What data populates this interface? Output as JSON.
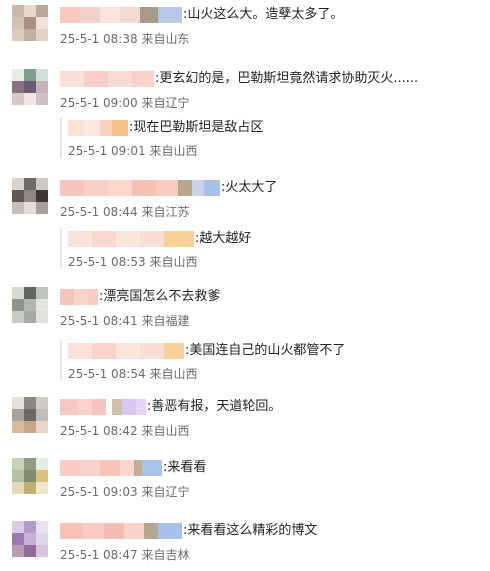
{
  "comments": [
    {
      "text": ":山火这么大。造孽太多了。",
      "date": "25-5-1 08:38",
      "location": "来自山东",
      "avatar_colors": [
        "#c9b8a8",
        "#e8d8cc",
        "#b9a79a",
        "#d3c1b3",
        "#a89182",
        "#efe3d9",
        "#dccbbd",
        "#c2b0a1",
        "#e2d3c6"
      ],
      "nick_colors": [
        "#f7c9c0",
        "#f3d2cc",
        "#fbe3de",
        "#f5d8d2",
        "#a79a86",
        "#b7c7e6"
      ]
    },
    {
      "text": ":更玄幻的是，巴勒斯坦竟然请求协助灭火......",
      "date": "25-5-1 09:00",
      "location": "来自辽宁",
      "avatar_colors": [
        "#e6ece6",
        "#7fa08c",
        "#d4ddd8",
        "#8c6f7c",
        "#6a5c72",
        "#c7b3bb",
        "#d9c6c9",
        "#f1e5e6",
        "#cfc0c6"
      ],
      "nick_colors": [
        "#fbe0da",
        "#f7cfc8",
        "#fadbd3",
        "#f8d2c8"
      ],
      "replies": [
        {
          "text": ":现在巴勒斯坦是敌占区",
          "date": "25-5-1 09:01",
          "location": "来自山西",
          "nick_colors": [
            "#fde1d8",
            "#fbe8df",
            "#f8d1bf",
            "#f8c48a"
          ]
        }
      ]
    },
    {
      "text": ":火太大了",
      "date": "25-5-1 08:44",
      "location": "来自江苏",
      "avatar_colors": [
        "#d9d4cf",
        "#6f6a66",
        "#cfc9c4",
        "#5e5853",
        "#8e8883",
        "#3d3936",
        "#c7bfb8",
        "#e2ddd8",
        "#a79f99"
      ],
      "nick_colors": [
        "#f7c6bd",
        "#f9cfc6",
        "#fad6ce",
        "#f6c1b5",
        "#f8cbc0",
        "#b9a48d",
        "#c8d3e9",
        "#a6c2e8"
      ],
      "replies": [
        {
          "text": ":越大越好",
          "date": "25-5-1 08:53",
          "location": "来自山西",
          "nick_colors": [
            "#fbe3dc",
            "#f8d8cf",
            "#fbe6de",
            "#f9ddd2",
            "#f8cf95"
          ]
        }
      ]
    },
    {
      "text": ":漂亮国怎么不去救爹",
      "date": "25-5-1 08:41",
      "location": "来自福建",
      "avatar_colors": [
        "#d6d8d4",
        "#62665e",
        "#c1c5bf",
        "#8f948b",
        "#b3b7b0",
        "#e3e6e0",
        "#c9ccc6",
        "#a5aaa2",
        "#dfe2dc"
      ],
      "nick_colors": [
        "#f6c4bb",
        "#fad3cb",
        "#f7cbc2"
      ],
      "replies": [
        {
          "text": ":美国连自己的山火都管不了",
          "date": "25-5-1 08:54",
          "location": "来自山西",
          "nick_colors": [
            "#fbe1d9",
            "#f8d4ca",
            "#fbe6dd",
            "#f9dcd2",
            "#f8d09a"
          ]
        }
      ]
    },
    {
      "text": ":善恶有报，天道轮回。",
      "date": "25-5-1 08:42",
      "location": "来自山西",
      "avatar_colors": [
        "#e4e0dc",
        "#8d8781",
        "#d2ccc7",
        "#a9a29c",
        "#6e6964",
        "#c3bcb5",
        "#d9b99b",
        "#c8a685",
        "#e6d7c8"
      ],
      "nick_colors": [
        "#f7cac1",
        "#fad4cc",
        "#f6c6bc",
        "#ffffff",
        "#cfc2a9",
        "#d8c7f2",
        "#e3d3f7"
      ]
    },
    {
      "text": ":来看看",
      "date": "25-5-1 09:03",
      "location": "来自辽宁",
      "avatar_colors": [
        "#c8d2b9",
        "#8f9c7d",
        "#e5ece0",
        "#b3c1a0",
        "#7f8b6c",
        "#d8c27c",
        "#e3d9b8",
        "#c2ae74",
        "#f0e7c9"
      ],
      "nick_colors": [
        "#f8cac1",
        "#f9d3cb",
        "#f7c4ba",
        "#fad6ce",
        "#c0ae98",
        "#a7c3ec"
      ]
    },
    {
      "text": ":来看看这么精彩的博文",
      "date": "25-5-1 08:47",
      "location": "来自吉林",
      "avatar_colors": [
        "#d8cde3",
        "#b59cc8",
        "#e8e0ef",
        "#9a78b3",
        "#c5b1d6",
        "#e0d5ea",
        "#b99bb0",
        "#8f6c9a",
        "#d5c4de"
      ],
      "nick_colors": [
        "#f6c1b7",
        "#f8cbc2",
        "#f5bdb2",
        "#f9d2ca",
        "#b5a78f",
        "#a6c2ec"
      ]
    }
  ]
}
